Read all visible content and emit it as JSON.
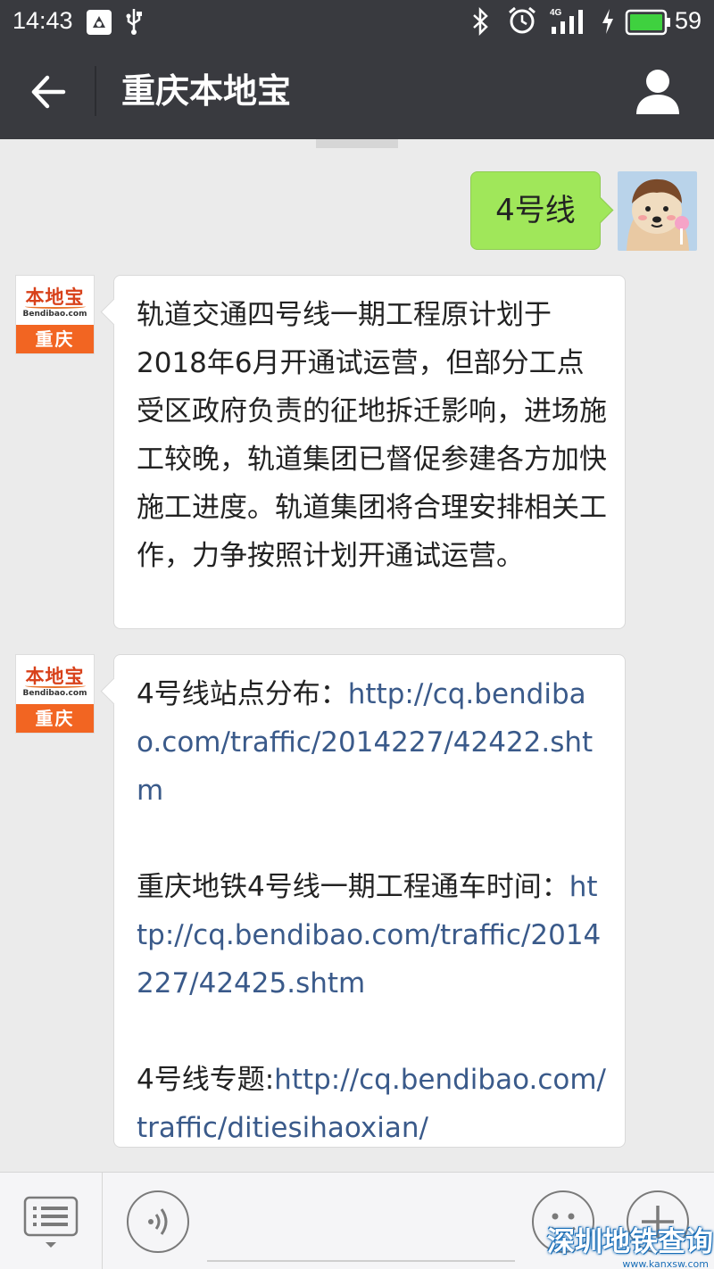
{
  "status_bar": {
    "time": "14:43",
    "battery_percent": "59",
    "network": "4G",
    "icons": [
      "app-notification-icon",
      "usb-icon",
      "bluetooth-icon",
      "alarm-icon",
      "signal-icon",
      "charging-icon",
      "battery-icon"
    ]
  },
  "header": {
    "title": "重庆本地宝",
    "back_icon": "back-arrow-icon",
    "profile_icon": "person-icon"
  },
  "brand_avatar": {
    "name": "本地宝",
    "url": "Bendibao.com",
    "city": "重庆"
  },
  "messages": [
    {
      "from": "user",
      "text": "4号线"
    },
    {
      "from": "official",
      "text": "轨道交通四号线一期工程原计划于2018年6月开通试运营，但部分工点受区政府负责的征地拆迁影响，进场施工较晚，轨道集团已督促参建各方加快施工进度。轨道集团将合理安排相关工作，力争按照计划开通试运营。"
    },
    {
      "from": "official",
      "items": [
        {
          "label": "4号线站点分布：",
          "link": "http://cq.bendibao.com/traffic/2014227/42422.shtm"
        },
        {
          "label": "重庆地铁4号线一期工程通车时间：",
          "link": "http://cq.bendibao.com/traffic/2014227/42425.shtm"
        },
        {
          "label": "4号线专题:",
          "link": "http://cq.bendibao.com/traffic/ditiesihaoxian/"
        }
      ]
    }
  ],
  "bottom_bar": {
    "input_placeholder": "",
    "icons": [
      "menu-list-icon",
      "voice-icon",
      "emoji-icon",
      "plus-icon"
    ]
  },
  "watermark": {
    "text": "深圳地铁查询",
    "url": "www.kanxsw.com"
  },
  "colors": {
    "header_bg": "#393a3f",
    "chat_bg": "#ebebeb",
    "bubble_out": "#a0e75a",
    "link": "#3a5a8a",
    "brand_orange": "#f26522"
  }
}
